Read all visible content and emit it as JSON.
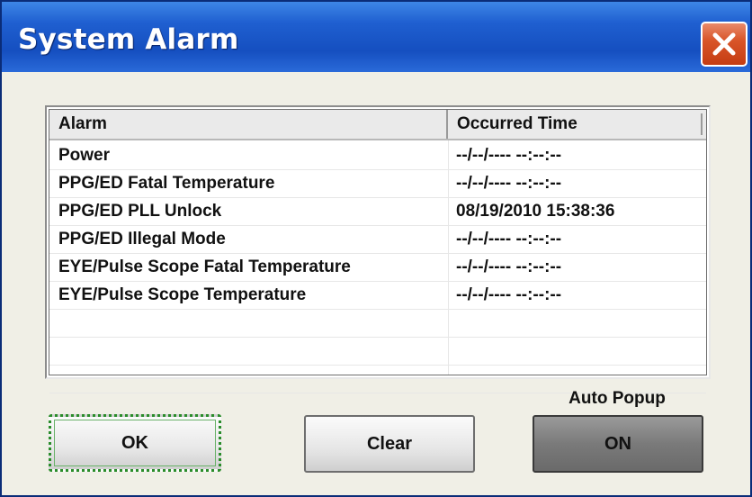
{
  "window": {
    "title": "System Alarm"
  },
  "table": {
    "columns": [
      "Alarm",
      "Occurred Time"
    ],
    "rows": [
      {
        "alarm": "Power",
        "time": "--/--/---- --:--:--"
      },
      {
        "alarm": "PPG/ED Fatal Temperature",
        "time": "--/--/---- --:--:--"
      },
      {
        "alarm": "PPG/ED PLL Unlock",
        "time": "08/19/2010 15:38:36"
      },
      {
        "alarm": "PPG/ED Illegal Mode",
        "time": "--/--/---- --:--:--"
      },
      {
        "alarm": "EYE/Pulse Scope Fatal Temperature",
        "time": "--/--/---- --:--:--"
      },
      {
        "alarm": "EYE/Pulse Scope Temperature",
        "time": "--/--/---- --:--:--"
      },
      {
        "alarm": "",
        "time": ""
      },
      {
        "alarm": "",
        "time": ""
      },
      {
        "alarm": "",
        "time": ""
      }
    ]
  },
  "buttons": {
    "ok": "OK",
    "clear": "Clear",
    "auto_popup_label": "Auto Popup",
    "auto_popup_value": "ON"
  },
  "colors": {
    "titlebar": "#1f5fd0",
    "close": "#d9562a",
    "background": "#f0efe6"
  }
}
